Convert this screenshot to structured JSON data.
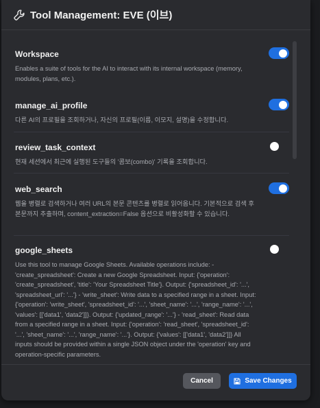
{
  "header": {
    "title": "Tool Management: EVE (이브)",
    "icon": "wrench-icon"
  },
  "tools": [
    {
      "name": "Workspace",
      "description": "Enables a suite of tools for the AI to interact with its internal workspace (memory, modules, plans, etc.).",
      "enabled": true
    },
    {
      "name": "manage_ai_profile",
      "description": "다른 AI의 프로필을 조회하거나, 자신의 프로필(이름, 이모지, 설명)을 수정합니다.",
      "enabled": true
    },
    {
      "name": "review_task_context",
      "description": "현재 세션에서 최근에 실행된 도구들의 '콤보(combo)' 기록을 조회합니다.",
      "enabled": false
    },
    {
      "name": "web_search",
      "description": "웹을 병렬로 검색하거나 여러 URL의 본문 콘텐츠를 병렬로 읽어옵니다. 기본적으로 검색 후 본문까지 추출하며, content_extraction=False 옵션으로 비활성화할 수 있습니다.",
      "enabled": true
    },
    {
      "name": "google_sheets",
      "description": "Use this tool to manage Google Sheets. Available operations include: - 'create_spreadsheet': Create a new Google Spreadsheet. Input: {'operation': 'create_spreadsheet', 'title': 'Your Spreadsheet Title'}. Output: {'spreadsheet_id': '...', 'spreadsheet_url': '...'} - 'write_sheet': Write data to a specified range in a sheet. Input: {'operation': 'write_sheet', 'spreadsheet_id': '...', 'sheet_name': '...', 'range_name': '...', 'values': [['data1', 'data2']]}. Output: {'updated_range': '...'} - 'read_sheet': Read data from a specified range in a sheet. Input: {'operation': 'read_sheet', 'spreadsheet_id': '...', 'sheet_name': '...', 'range_name': '...'}. Output: {'values': [['data1', 'data2']]} All inputs should be provided within a single JSON object under the 'operation' key and operation-specific parameters.",
      "enabled": false
    }
  ],
  "footer": {
    "cancel_label": "Cancel",
    "save_label": "Save Changes",
    "save_icon": "save-icon"
  },
  "colors": {
    "accent": "#1f6fe0",
    "background": "#2a2b2f",
    "cancel_button": "#55575d"
  }
}
